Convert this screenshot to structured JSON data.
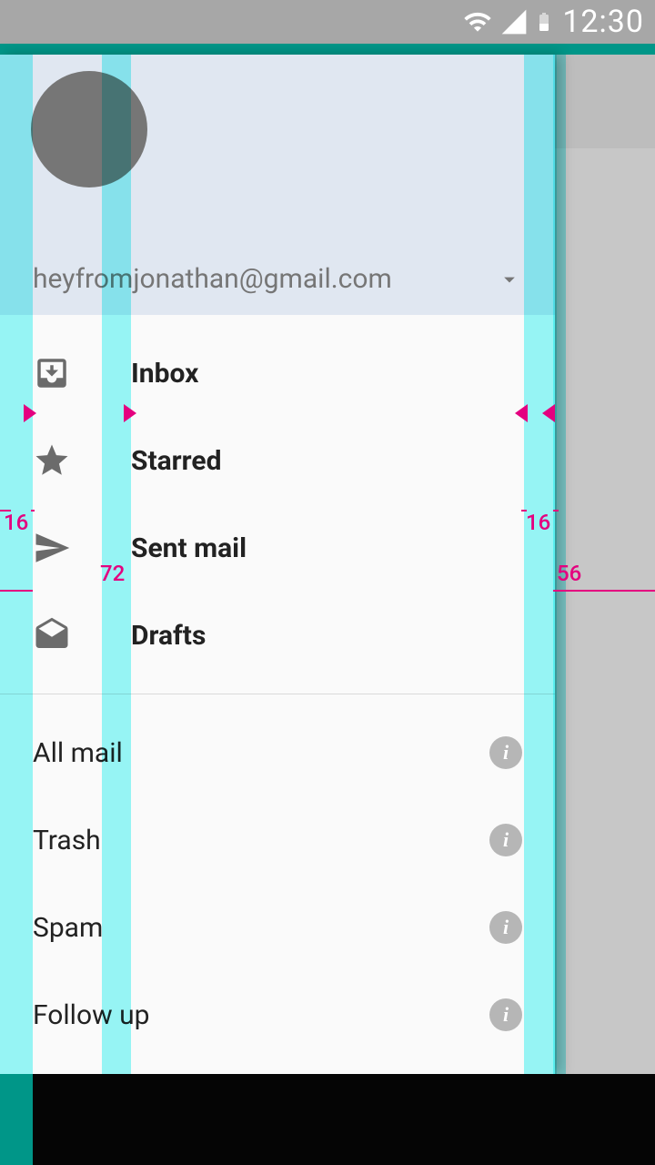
{
  "status": {
    "time": "12:30"
  },
  "drawer": {
    "email": "heyfromjonathan@gmail.com",
    "primary": [
      {
        "label": "Inbox"
      },
      {
        "label": "Starred"
      },
      {
        "label": "Sent mail"
      },
      {
        "label": "Drafts"
      }
    ],
    "secondary": [
      {
        "label": "All mail"
      },
      {
        "label": "Trash"
      },
      {
        "label": "Spam"
      },
      {
        "label": "Follow up"
      }
    ]
  },
  "keylines": {
    "left_margin": "16",
    "icon_text_gutter": "72",
    "drawer_right_margin": "16",
    "drawer_offset_right": "56"
  }
}
